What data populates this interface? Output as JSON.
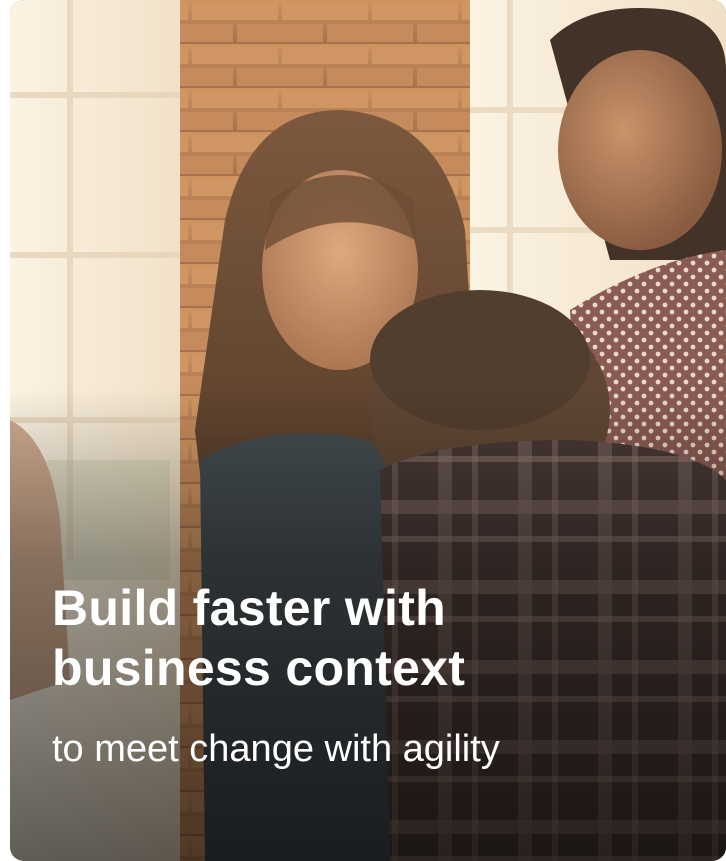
{
  "card": {
    "headline": "Build faster with business context",
    "subline": "to meet change with agility"
  },
  "colors": {
    "text": "#ffffff",
    "brick": "#b57a4a",
    "window": "#f5efe2",
    "plaid_dark": "#2f2426",
    "sweater": "#7a4a48"
  }
}
